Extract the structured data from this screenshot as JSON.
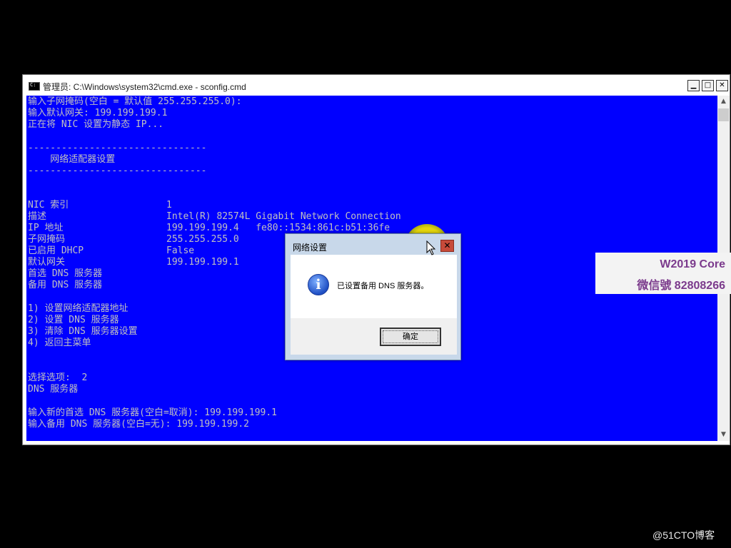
{
  "window": {
    "title": "管理员: C:\\Windows\\system32\\cmd.exe - sconfig.cmd",
    "min_label": "▁",
    "max_label": "□",
    "close_label": "✕"
  },
  "console": {
    "lines": [
      "输入子网掩码(空白 = 默认值 255.255.255.0):",
      "输入默认网关: 199.199.199.1",
      "正在将 NIC 设置为静态 IP...",
      "--------------------------------",
      "    网络适配器设置",
      "--------------------------------"
    ],
    "settings": [
      {
        "label": "NIC 索引",
        "value": "1"
      },
      {
        "label": "描述",
        "value": "Intel(R) 82574L Gigabit Network Connection"
      },
      {
        "label": "IP 地址",
        "value": "199.199.199.4   fe80::1534:861c:b51:36fe"
      },
      {
        "label": "子网掩码",
        "value": "255.255.255.0"
      },
      {
        "label": "已启用 DHCP",
        "value": "False"
      },
      {
        "label": "默认网关",
        "value": "199.199.199.1"
      },
      {
        "label": "首选 DNS 服务器",
        "value": ""
      },
      {
        "label": "备用 DNS 服务器",
        "value": ""
      }
    ],
    "menu": [
      "1) 设置网络适配器地址",
      "2) 设置 DNS 服务器",
      "3) 清除 DNS 服务器设置",
      "4) 返回主菜单"
    ],
    "tail": [
      "选择选项:  2",
      "DNS 服务器",
      "输入新的首选 DNS 服务器(空白=取消): 199.199.199.1",
      "输入备用 DNS 服务器(空白=无): 199.199.199.2"
    ]
  },
  "dialog": {
    "title": "网络设置",
    "message": "已设置备用 DNS 服务器。",
    "ok_label": "确定",
    "close_label": "✕"
  },
  "overlay": {
    "badge_line1": "W2019 Core",
    "badge_line2": "微信號 82808266",
    "watermark": "@51CTO博客"
  }
}
